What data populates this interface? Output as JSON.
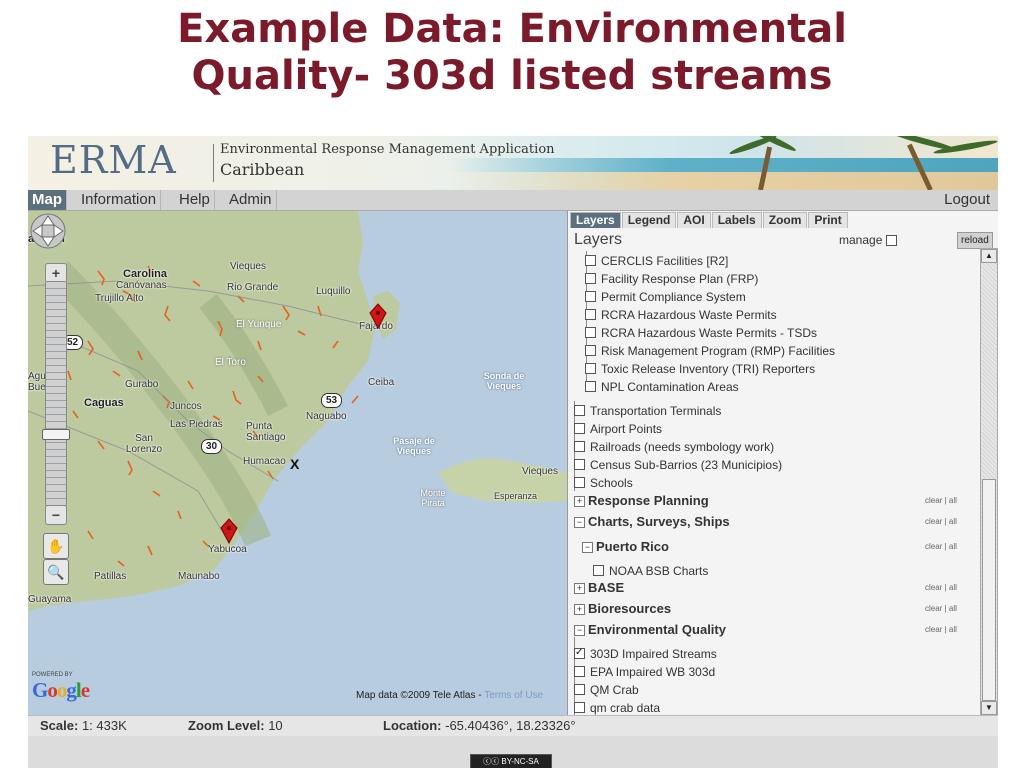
{
  "slide": {
    "title_line1": "Example Data: Environmental",
    "title_line2": "Quality- 303d listed streams"
  },
  "header": {
    "logo": "ERMA",
    "subtitle1": "Environmental Response Management Application",
    "subtitle2": "Caribbean"
  },
  "menu": {
    "items": [
      "Map",
      "Information",
      "Help",
      "Admin"
    ],
    "active": "Map",
    "logout": "Logout"
  },
  "map": {
    "places": [
      "Carolina",
      "Canóvanas",
      "Trujillo Alto",
      "Vieques",
      "Rio Grande",
      "Luquillo",
      "Fajardo",
      "El Yunque",
      "El Toro",
      "Ceiba",
      "Gurabo",
      "Caguas",
      "Juncos",
      "Las Piedras",
      "Punta Santiago",
      "Naguabo",
      "San Lorenzo",
      "Humacao",
      "Yabucoa",
      "Patillas",
      "Maunabo",
      "Guayama",
      "Sonda de Vieques",
      "Pasaje de Vieques",
      "Vieques",
      "Monte Pirata",
      "Esperanza",
      "Agu",
      "Buenas",
      "an",
      "an"
    ],
    "route_shields": [
      "52",
      "53",
      "30"
    ],
    "x_marker": "X",
    "attribution_powered": "POWERED BY",
    "attribution_google": "Google",
    "map_data": "Map data ©2009 Tele Atlas - ",
    "terms": "Terms of Use"
  },
  "panel": {
    "tabs": [
      "Layers",
      "Legend",
      "AOI",
      "Labels",
      "Zoom",
      "Print"
    ],
    "active_tab": "Layers",
    "heading": "Layers",
    "manage_label": "manage",
    "reload_label": "reload",
    "sub_layers": [
      "CERCLIS Facilities [R2]",
      "Facility Response Plan (FRP)",
      "Permit Compliance System",
      "RCRA Hazardous Waste Permits",
      "RCRA Hazardous Waste Permits - TSDs",
      "Risk Management Program (RMP) Facilities",
      "Toxic Release Inventory (TRI) Reporters",
      "NPL Contamination Areas"
    ],
    "layers": [
      "Transportation Terminals",
      "Airport Points",
      "Railroads (needs symbology work)",
      "Census Sub-Barrios (23 Municipios)",
      "Schools"
    ],
    "groups": {
      "response_planning": "Response Planning",
      "charts": "Charts, Surveys, Ships",
      "puerto_rico": "Puerto Rico",
      "noaa": "NOAA BSB Charts",
      "base": "BASE",
      "bioresources": "Bioresources",
      "env_quality": "Environmental Quality"
    },
    "clear_all": "clear | all",
    "env_layers": [
      "303D Impaired Streams",
      "EPA Impaired WB 303d",
      "QM Crab",
      "qm crab data"
    ],
    "env_checked": [
      true,
      false,
      false,
      false
    ]
  },
  "status": {
    "scale_label": "Scale:",
    "scale_value": "1: 433K",
    "zoom_label": "Zoom Level:",
    "zoom_value": "10",
    "loc_label": "Location:",
    "loc_value": "-65.40436°, 18.23326°"
  },
  "license_badge": "BY-NC-SA",
  "colors": {
    "title": "#7b1a2b",
    "active_tab": "#5c6f7d",
    "land": "#b8c79d",
    "water": "#b8ccdf",
    "marker": "#d01515",
    "stream": "#e8601c"
  }
}
